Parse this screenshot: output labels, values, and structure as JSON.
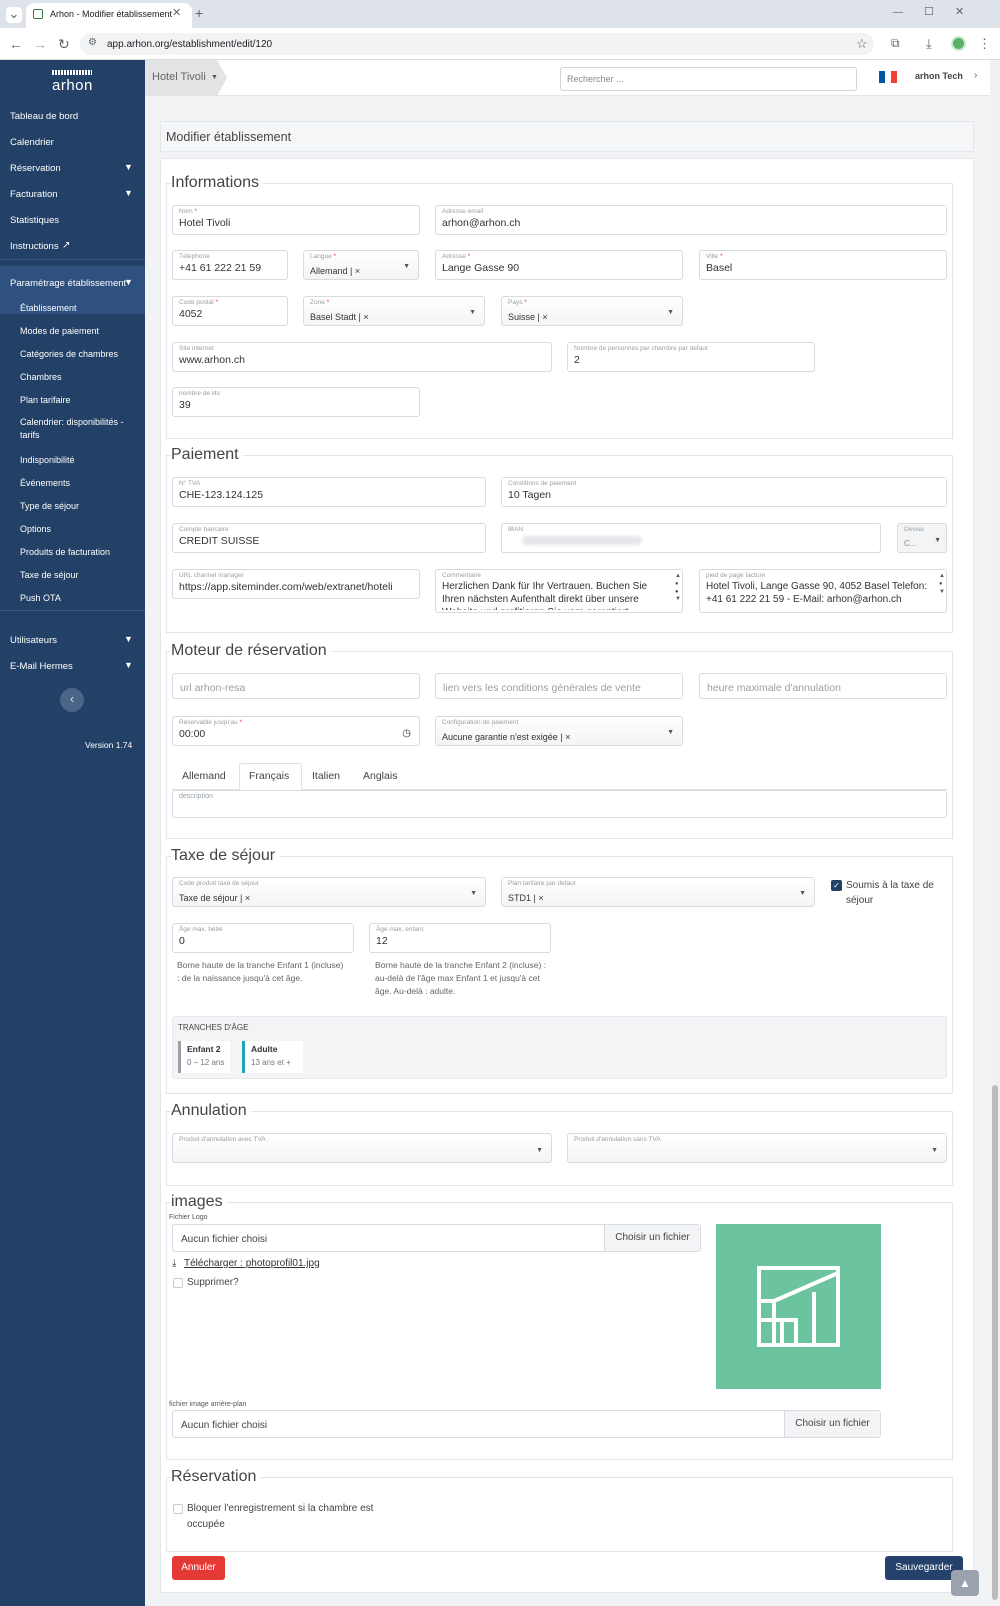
{
  "browser": {
    "tab_title": "Arhon - Modifier établissement",
    "url": "app.arhon.org/establishment/edit/120",
    "new_tab": "+",
    "window_controls": [
      "—",
      "☐",
      "✕"
    ]
  },
  "sidebar": {
    "logo": "arhon",
    "items": [
      {
        "label": "Tableau de bord"
      },
      {
        "label": "Calendrier"
      },
      {
        "label": "Réservation"
      },
      {
        "label": "Facturation"
      },
      {
        "label": "Statistiques"
      },
      {
        "label": "Instructions"
      },
      {
        "label": "Paramétrage établissement"
      }
    ],
    "sub_items": [
      {
        "label": "Établissement"
      },
      {
        "label": "Modes de paiement"
      },
      {
        "label": "Catégories de chambres"
      },
      {
        "label": "Chambres"
      },
      {
        "label": "Plan tarifaire"
      },
      {
        "label": "Calendrier: disponibilités - tarifs"
      },
      {
        "label": "Indisponibilité"
      },
      {
        "label": "Événements"
      },
      {
        "label": "Type de séjour"
      },
      {
        "label": "Options"
      },
      {
        "label": "Produits de facturation"
      },
      {
        "label": "Taxe de séjour"
      },
      {
        "label": "Push OTA"
      }
    ],
    "bottom_items": [
      {
        "label": "Utilisateurs"
      },
      {
        "label": "E-Mail Hermes"
      }
    ],
    "collapse_icon": "‹",
    "version": "Version 1.74"
  },
  "topbar": {
    "hotel": "Hotel Tivoli",
    "search_placeholder": "Rechercher ...",
    "user": "arhon Tech"
  },
  "page_title": "Modifier établissement",
  "informations": {
    "title": "Informations",
    "nom": {
      "label": "Nom",
      "value": "Hotel Tivoli"
    },
    "email": {
      "label": "Adresse email",
      "value": "arhon@arhon.ch"
    },
    "telephone": {
      "label": "Téléphone",
      "value": "+41 61 222 21 59"
    },
    "langue": {
      "label": "Langue",
      "value": "Allemand"
    },
    "adresse": {
      "label": "Adresse",
      "value": "Lange Gasse 90"
    },
    "ville": {
      "label": "Ville",
      "value": "Basel"
    },
    "code_postal": {
      "label": "Code postal",
      "value": "4052"
    },
    "zone": {
      "label": "Zone",
      "value": "Basel Stadt"
    },
    "pays": {
      "label": "Pays",
      "value": "Suisse"
    },
    "site": {
      "label": "Site internet",
      "value": "www.arhon.ch"
    },
    "personnes": {
      "label": "Nombre de personnes par chambre par defaut",
      "value": "2"
    },
    "lits": {
      "label": "nombre de lits",
      "value": "39"
    }
  },
  "paiement": {
    "title": "Paiement",
    "tva": {
      "label": "N° TVA",
      "value": "CHE-123.124.125"
    },
    "conditions": {
      "label": "Conditions de paiement",
      "value": "10 Tagen"
    },
    "compte": {
      "label": "Compte bancaire",
      "value": "CREDIT SUISSE"
    },
    "iban": {
      "label": "IBAN"
    },
    "devise": {
      "label": "Devise",
      "value": "C..."
    },
    "channel": {
      "label": "URL channel manager",
      "value": "https://app.siteminder.com/web/extranet/hoteli"
    },
    "commentaire": {
      "label": "Commentaire",
      "value": "Herzlichen Dank für Ihr Vertrauen. Buchen Sie Ihren nächsten Aufenthalt direkt über unsere Website und profitieren Sie vom garantiert"
    },
    "pied": {
      "label": "pied de page facture",
      "value": "Hotel Tivoli, Lange Gasse 90, 4052 Basel Telefon: +41 61 222 21 59 - E-Mail: arhon@arhon.ch"
    }
  },
  "moteur": {
    "title": "Moteur de réservation",
    "url_placeholder": "url arhon-resa",
    "cgv_placeholder": "lien vers les conditions générales de vente",
    "heure_placeholder": "heure maximale d'annulation",
    "reservable": {
      "label": "Réservable jusqu'au",
      "value": "00:00"
    },
    "config": {
      "label": "Configuration de paiement",
      "value": "Aucune garantie n'est exigée"
    },
    "tabs": [
      "Allemand",
      "Français",
      "Italien",
      "Anglais"
    ],
    "description_label": "description"
  },
  "taxe": {
    "title": "Taxe de séjour",
    "code": {
      "label": "Code produit taxe de séjour",
      "value": "Taxe de séjour"
    },
    "plan": {
      "label": "Plan tarifaire par defaut",
      "value": "STD1"
    },
    "soumis": "Soumis à la taxe de séjour",
    "bebe": {
      "label": "Âge max. bébé",
      "value": "0"
    },
    "enfant": {
      "label": "Âge max. enfant",
      "value": "12"
    },
    "help1": "Borne haute de la tranche Enfant 1 (incluse) : de la naissance jusqu'à cet âge.",
    "help2": "Borne haute de la tranche Enfant 2 (incluse) : au-delà de l'âge max Enfant 1 et jusqu'à cet âge. Au-delà : adulte.",
    "tranches_title": "TRANCHES D'ÂGE",
    "tranches": [
      {
        "name": "Enfant 2",
        "range": "0 – 12 ans"
      },
      {
        "name": "Adulte",
        "range": "13 ans et +"
      }
    ]
  },
  "annulation": {
    "title": "Annulation",
    "avec": "Produit d'annulation avec TVA",
    "sans": "Produit d'annulation sans TVA"
  },
  "images": {
    "title": "images",
    "logo_label": "Fichier Logo",
    "no_file": "Aucun fichier choisi",
    "choose": "Choisir un fichier",
    "download": "Télécharger : photoprofil01.jpg",
    "delete": "Supprimer?",
    "bg_label": "fichier image arrière-plan",
    "image_color": "#6cc49f"
  },
  "reservation": {
    "title": "Réservation",
    "block": "Bloquer l'enregistrement si la chambre est occupée"
  },
  "actions": {
    "cancel": "Annuler",
    "save": "Sauvegarder"
  },
  "colors": {
    "sidebar": "#234066",
    "cancel": "#e53935",
    "save": "#24426b"
  }
}
